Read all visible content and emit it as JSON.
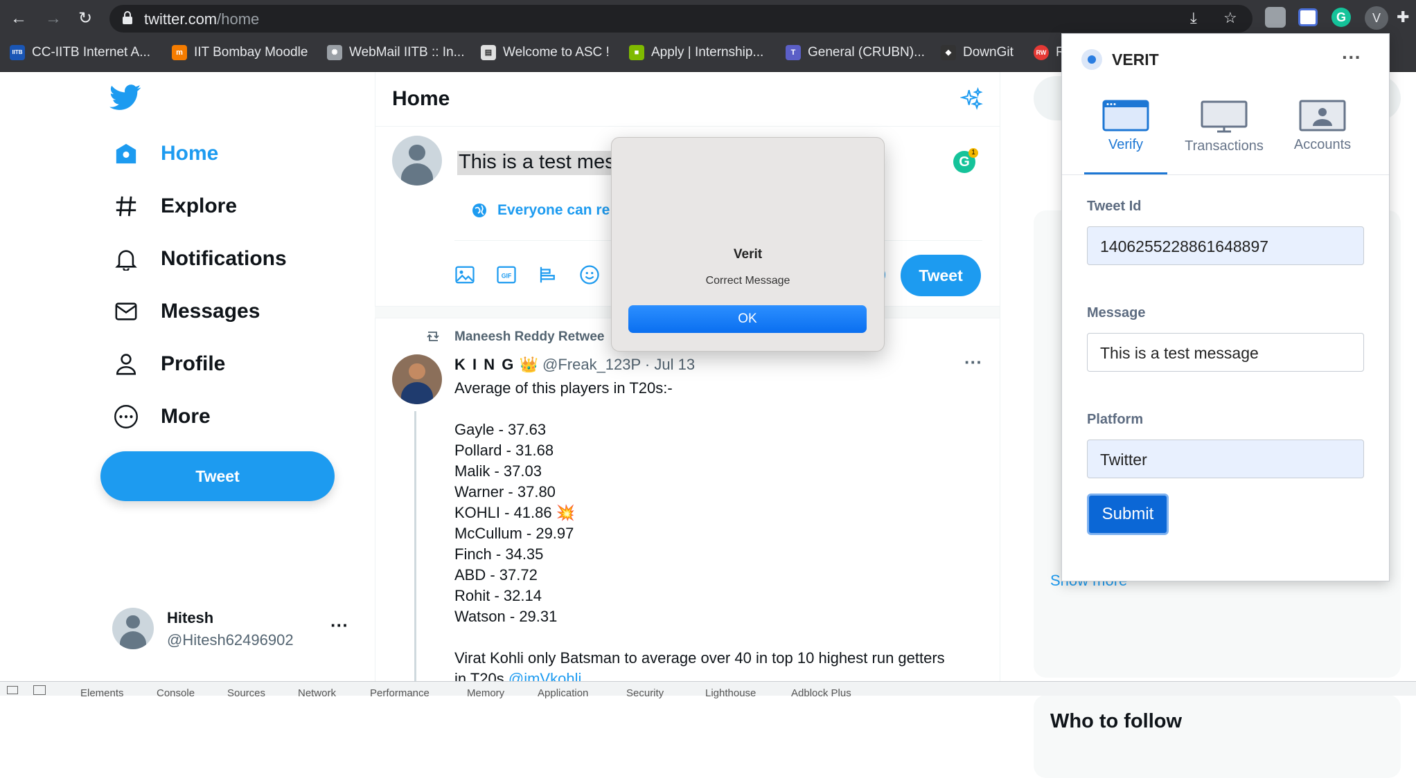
{
  "browser": {
    "url_host": "twitter.com",
    "url_path": "/home",
    "bookmarks": [
      {
        "label": "CC-IITB Internet A...",
        "color": "#1a56b5",
        "glyph": "IITB"
      },
      {
        "label": "IIT Bombay Moodle",
        "color": "#f57c00",
        "glyph": "m"
      },
      {
        "label": "WebMail IITB :: In...",
        "color": "#9aa0a6",
        "glyph": "✺"
      },
      {
        "label": "Welcome to ASC !",
        "color": "#e0e0e0",
        "glyph": "▤"
      },
      {
        "label": "Apply | Internship...",
        "color": "#7fba00",
        "glyph": "■"
      },
      {
        "label": "General (CRUBN)...",
        "color": "#5b5fc7",
        "glyph": "T"
      },
      {
        "label": "DownGit",
        "color": "#333333",
        "glyph": "◆"
      },
      {
        "label": "R",
        "color": "#e53935",
        "glyph": "RW"
      }
    ]
  },
  "sidebar": {
    "items": [
      {
        "label": "Home",
        "icon": "home-icon"
      },
      {
        "label": "Explore",
        "icon": "hashtag-icon"
      },
      {
        "label": "Notifications",
        "icon": "bell-icon"
      },
      {
        "label": "Messages",
        "icon": "mail-icon"
      },
      {
        "label": "Profile",
        "icon": "person-icon"
      },
      {
        "label": "More",
        "icon": "more-circle-icon"
      }
    ],
    "tweet_button": "Tweet",
    "account": {
      "name": "Hitesh",
      "handle": "@Hitesh62496902"
    }
  },
  "main": {
    "title": "Home",
    "composer": {
      "text_visible": "This is a test mes",
      "reply_setting": "Everyone can re",
      "tweet_button": "Tweet"
    },
    "tweet": {
      "retweeted_by": "Maneesh Reddy Retwee",
      "author_name": "K I N G",
      "author_handle": "@Freak_123P",
      "date": "· Jul 13",
      "intro": "Average of this players in T20s:-",
      "stats": [
        "Gayle - 37.63",
        "Pollard - 31.68",
        "Malik - 37.03",
        "Warner - 37.80",
        "KOHLI - 41.86 💥",
        "McCullum - 29.97",
        "Finch - 34.35",
        "ABD - 37.72",
        "Rohit - 32.14",
        "Watson - 29.31"
      ],
      "footer_line1": "Virat Kohli only Batsman to average over 40 in top 10 highest run getters",
      "footer_line2_prefix": "in T20s",
      "footer_mention": "@imVkohli"
    }
  },
  "right": {
    "show_more": "Show more",
    "who_to_follow": "Who to follow"
  },
  "extension": {
    "title": "VERIT",
    "tabs": [
      "Verify",
      "Transactions",
      "Accounts"
    ],
    "tweet_id_label": "Tweet Id",
    "tweet_id_value": "1406255228861648897",
    "message_label": "Message",
    "message_value": "This is a test message",
    "platform_label": "Platform",
    "platform_value": "Twitter",
    "submit_label": "Submit"
  },
  "dialog": {
    "title": "Verit",
    "message": "Correct Message",
    "ok_label": "OK"
  },
  "devtools": {
    "tabs": [
      "Elements",
      "Console",
      "Sources",
      "Network",
      "Performance",
      "Memory",
      "Application",
      "Security",
      "Lighthouse",
      "Adblock Plus"
    ]
  }
}
